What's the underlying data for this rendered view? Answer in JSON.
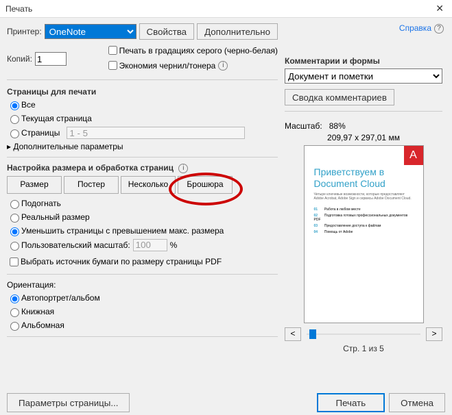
{
  "title": "Печать",
  "help_link": "Справка",
  "top": {
    "printer_label": "Принтер:",
    "printer_value": "OneNote",
    "properties_btn": "Свойства",
    "advanced_btn": "Дополнительно",
    "copies_label": "Копий:",
    "copies_value": "1",
    "grayscale_label": "Печать в градациях серого (черно-белая)",
    "ink_label": "Экономия чернил/тонера"
  },
  "pages": {
    "title": "Страницы для печати",
    "all": "Все",
    "current": "Текущая страница",
    "range_label": "Страницы",
    "range_value": "1 - 5",
    "more": "▸  Дополнительные параметры"
  },
  "sizing": {
    "title": "Настройка размера и обработка страниц",
    "tab_size": "Размер",
    "tab_poster": "Постер",
    "tab_multiple": "Несколько",
    "tab_booklet": "Брошюра",
    "fit": "Подогнать",
    "actual": "Реальный размер",
    "shrink": "Уменьшить страницы с превышением макс. размера",
    "custom": "Пользовательский масштаб:",
    "custom_value": "100",
    "percent": "%",
    "paper_source": "Выбрать источник бумаги по размеру страницы PDF"
  },
  "orientation": {
    "title": "Ориентация:",
    "auto": "Автопортрет/альбом",
    "portrait": "Книжная",
    "landscape": "Альбомная"
  },
  "comments": {
    "title": "Комментарии и формы",
    "value": "Документ и пометки",
    "summary_btn": "Сводка комментариев"
  },
  "preview": {
    "scale_label": "Масштаб:",
    "scale_value": "88%",
    "dimensions": "209,97 x 297,01 мм",
    "badge": "A",
    "doc_title1": "Приветствуем в",
    "doc_title2": "Document Cloud",
    "doc_sub": "Четыре ключевые возможности, которые предоставляют Adobe Acrobat, Adobe Sign и сервисы Adobe Document Cloud.",
    "items": [
      {
        "n": "01",
        "t": "Работа в любом месте"
      },
      {
        "n": "02",
        "t": "Подготовка готовых профессиональных документов PDF"
      },
      {
        "n": "03",
        "t": "Предоставление доступа к файлам"
      },
      {
        "n": "04",
        "t": "Помощь от Adobe"
      }
    ],
    "prev": "<",
    "next": ">",
    "page_indicator": "Стр. 1 из 5"
  },
  "footer": {
    "page_setup": "Параметры страницы...",
    "print": "Печать",
    "cancel": "Отмена"
  }
}
